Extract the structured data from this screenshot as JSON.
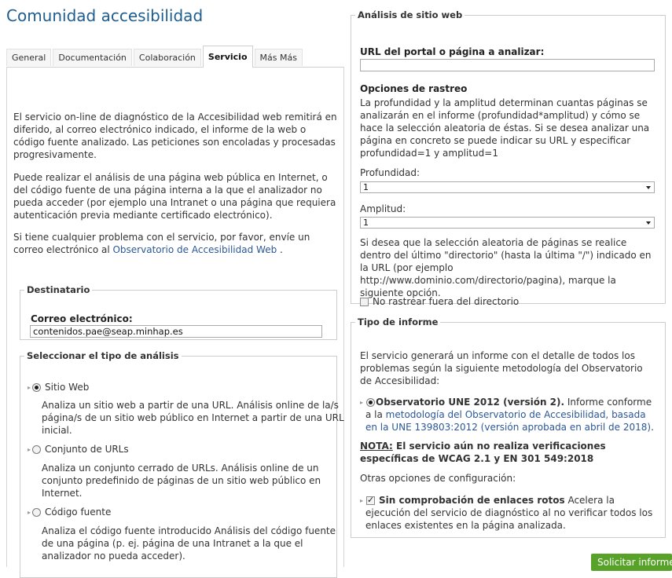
{
  "page": {
    "title": "Comunidad accesibilidad"
  },
  "tabs": [
    "General",
    "Documentación",
    "Colaboración",
    "Servicio",
    "Más Más"
  ],
  "active_tab_index": 3,
  "intro": {
    "p1": "El servicio on-line de diagnóstico de la Accesibilidad web remitirá en diferido, al correo electrónico indicado, el informe de la web o código fuente analizado. Las peticiones son encoladas y procesadas progresivamente.",
    "p2": "Puede realizar el análisis de una página web pública en Internet, o del código fuente de una página interna a la que el analizador no pueda acceder (por ejemplo una Intranet o una página que requiera autenticación previa mediante certificado electrónico).",
    "p3_prefix": "Si tiene cualquier problema con el servicio, por favor, envíe un correo electrónico al ",
    "p3_link": "Observatorio de Accesibilidad Web",
    "p3_suffix": " ."
  },
  "destinatario": {
    "legend": "Destinatario",
    "email_label": "Correo electrónico:",
    "email_value": "contenidos.pae@seap.minhap.es"
  },
  "analysis_type": {
    "legend": "Seleccionar el tipo de análisis",
    "options": [
      {
        "label": "Sitio Web",
        "selected": true,
        "desc": "Analiza un sitio web a partir de una URL. Análisis online de la/s página/s de un sitio web público en Internet a partir de una URL inicial."
      },
      {
        "label": "Conjunto de URLs",
        "selected": false,
        "desc": "Analiza un conjunto cerrado de URLs. Análisis online de un conjunto predefinido de páginas de un sitio web público en Internet."
      },
      {
        "label": "Código fuente",
        "selected": false,
        "desc": "Analiza el código fuente introducido Análisis del código fuente de una página (p. ej. página de una Intranet a la que el analizador no pueda acceder)."
      }
    ]
  },
  "site_analysis": {
    "legend": "Análisis de sitio web",
    "url_label": "URL del portal o página a analizar:",
    "url_value": "",
    "crawl_title": "Opciones de rastreo",
    "crawl_desc": "La profundidad y la amplitud determinan cuantas páginas se analizarán en el informe (profundidad*amplitud) y cómo se hace la selección aleatoria de éstas. Si se desea analizar una página en concreto se puede indicar su URL y especificar profundidad=1 y amplitud=1",
    "depth_label": "Profundidad:",
    "depth_value": "1",
    "width_label": "Amplitud:",
    "width_value": "1",
    "dir_desc": "Si desea que la selección aleatoria de páginas se realice dentro del último \"directorio\" (hasta la última \"/\") indicado en la URL (por ejemplo http://www.dominio.com/directorio/pagina), marque la siguiente opción.",
    "dir_checkbox_label": "No rastrear fuera del directorio",
    "dir_checkbox_checked": false
  },
  "report_type": {
    "legend": "Tipo de informe",
    "desc": "El servicio generará un informe con el detalle de todos los problemas según la siguiente metodología del Observatorio de Accesibilidad:",
    "option_label": "Observatorio UNE 2012 (versión 2).",
    "option_text": " Informe conforme a la ",
    "option_link": "metodología del Observatorio de Accesibilidad, basada en la UNE 139803:2012 (versión aprobada en abril de 2018)",
    "option_end": ".",
    "note_label": "NOTA:",
    "note_text": " El servicio aún no realiza verificaciones específicas de WCAG 2.1 y EN 301 549:2018",
    "other_options": "Otras opciones de configuración:",
    "broken_links_label": "Sin comprobación de enlaces rotos",
    "broken_links_desc": " Acelera la ejecución del servicio de diagnóstico al no verificar todos los enlaces existentes en la página analizada.",
    "broken_links_checked": true
  },
  "submit_label": "Solicitar informe",
  "colors": {
    "title": "#1d5d90",
    "link": "#2b5797",
    "submit": "#58a22a"
  }
}
